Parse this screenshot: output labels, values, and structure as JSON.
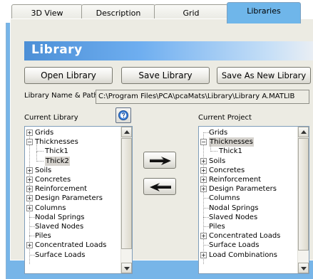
{
  "tabs": [
    {
      "label": "3D View"
    },
    {
      "label": "Description"
    },
    {
      "label": "Grid"
    },
    {
      "label": "Libraries",
      "active": true
    }
  ],
  "header": {
    "title": "Library"
  },
  "buttons": {
    "open": "Open Library",
    "save": "Save Library",
    "save_as": "Save As New Library"
  },
  "library_path": {
    "label": "Library Name & Path",
    "value": "C:\\Program Files\\PCA\\pcaMats\\Library\\Library A.MATLIB"
  },
  "current_library": {
    "label": "Current Library",
    "items": [
      {
        "label": "Grids",
        "expander": "+",
        "level": 0
      },
      {
        "label": "Thicknesses",
        "expander": "-",
        "level": 0
      },
      {
        "label": "Thick1",
        "level": 1
      },
      {
        "label": "Thick2",
        "level": 1,
        "selected": true
      },
      {
        "label": "Soils",
        "expander": "+",
        "level": 0
      },
      {
        "label": "Concretes",
        "expander": "+",
        "level": 0
      },
      {
        "label": "Reinforcement",
        "expander": "+",
        "level": 0
      },
      {
        "label": "Design Parameters",
        "expander": "+",
        "level": 0
      },
      {
        "label": "Columns",
        "expander": "+",
        "level": 0
      },
      {
        "label": "Nodal Springs",
        "level": 0
      },
      {
        "label": "Slaved Nodes",
        "level": 0
      },
      {
        "label": "Piles",
        "level": 0
      },
      {
        "label": "Concentrated Loads",
        "expander": "+",
        "level": 0
      },
      {
        "label": "Surface Loads",
        "level": 0
      }
    ]
  },
  "current_project": {
    "label": "Current Project",
    "items": [
      {
        "label": "Grids",
        "level": 0
      },
      {
        "label": "Thicknesses",
        "expander": "-",
        "level": 0,
        "selected": true
      },
      {
        "label": "Thick1",
        "level": 1
      },
      {
        "label": "Soils",
        "expander": "+",
        "level": 0
      },
      {
        "label": "Concretes",
        "expander": "+",
        "level": 0
      },
      {
        "label": "Reinforcement",
        "expander": "+",
        "level": 0
      },
      {
        "label": "Design Parameters",
        "expander": "+",
        "level": 0
      },
      {
        "label": "Columns",
        "level": 0
      },
      {
        "label": "Nodal Springs",
        "level": 0
      },
      {
        "label": "Slaved Nodes",
        "level": 0
      },
      {
        "label": "Piles",
        "level": 0
      },
      {
        "label": "Concentrated Loads",
        "expander": "+",
        "level": 0
      },
      {
        "label": "Surface Loads",
        "level": 0
      },
      {
        "label": "Load Combinations",
        "expander": "+",
        "level": 0
      }
    ]
  },
  "icons": {
    "help": "help-icon",
    "copy_right": "arrow-right-icon",
    "copy_left": "arrow-left-icon"
  },
  "colors": {
    "tab_active": "#6fb6ea",
    "panel": "#77b5e8",
    "header_gradient_start": "#4c8fd6",
    "selection": "#d6d3ce"
  }
}
